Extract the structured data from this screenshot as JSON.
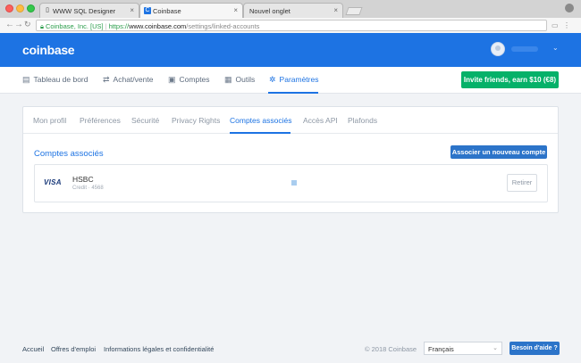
{
  "browser": {
    "tabs": [
      {
        "title": "WWW SQL Designer",
        "icon": "page-icon"
      },
      {
        "title": "Coinbase",
        "icon": "coinbase-favicon"
      },
      {
        "title": "Nouvel onglet",
        "icon": ""
      }
    ],
    "address": {
      "org": "Coinbase, Inc. [US]",
      "scheme": "https://",
      "host": "www.coinbase.com",
      "path": "/settings/linked-accounts"
    }
  },
  "header": {
    "logo": "coinbase"
  },
  "mainnav": {
    "items": [
      {
        "label": "Tableau de bord",
        "icon": "dashboard-icon",
        "glyph": "▤"
      },
      {
        "label": "Achat/vente",
        "icon": "swap-icon",
        "glyph": "⇄"
      },
      {
        "label": "Comptes",
        "icon": "wallet-icon",
        "glyph": "▣"
      },
      {
        "label": "Outils",
        "icon": "briefcase-icon",
        "glyph": "▦"
      },
      {
        "label": "Paramètres",
        "icon": "gear-icon",
        "glyph": "✲"
      }
    ],
    "invite": "Invite friends, earn $10 (€8)"
  },
  "settings": {
    "tabs": [
      "Mon profil",
      "Préférences",
      "Sécurité",
      "Privacy Rights",
      "Comptes associés",
      "Accès API",
      "Plafonds"
    ],
    "section_title": "Comptes associés",
    "add_button": "Associer un nouveau compte",
    "account": {
      "brand": "VISA",
      "name": "HSBC",
      "detail": "Credit · 4568",
      "remove": "Retirer"
    }
  },
  "footer": {
    "links": [
      "Accueil",
      "Offres d'emploi",
      "Informations légales et confidentialité"
    ],
    "copyright": "© 2018 Coinbase",
    "language": "Français",
    "help": "Besoin d'aide ?"
  },
  "colors": {
    "brand_blue": "#1d73e3",
    "invite_green": "#05b169",
    "button_blue": "#2c74c9"
  }
}
